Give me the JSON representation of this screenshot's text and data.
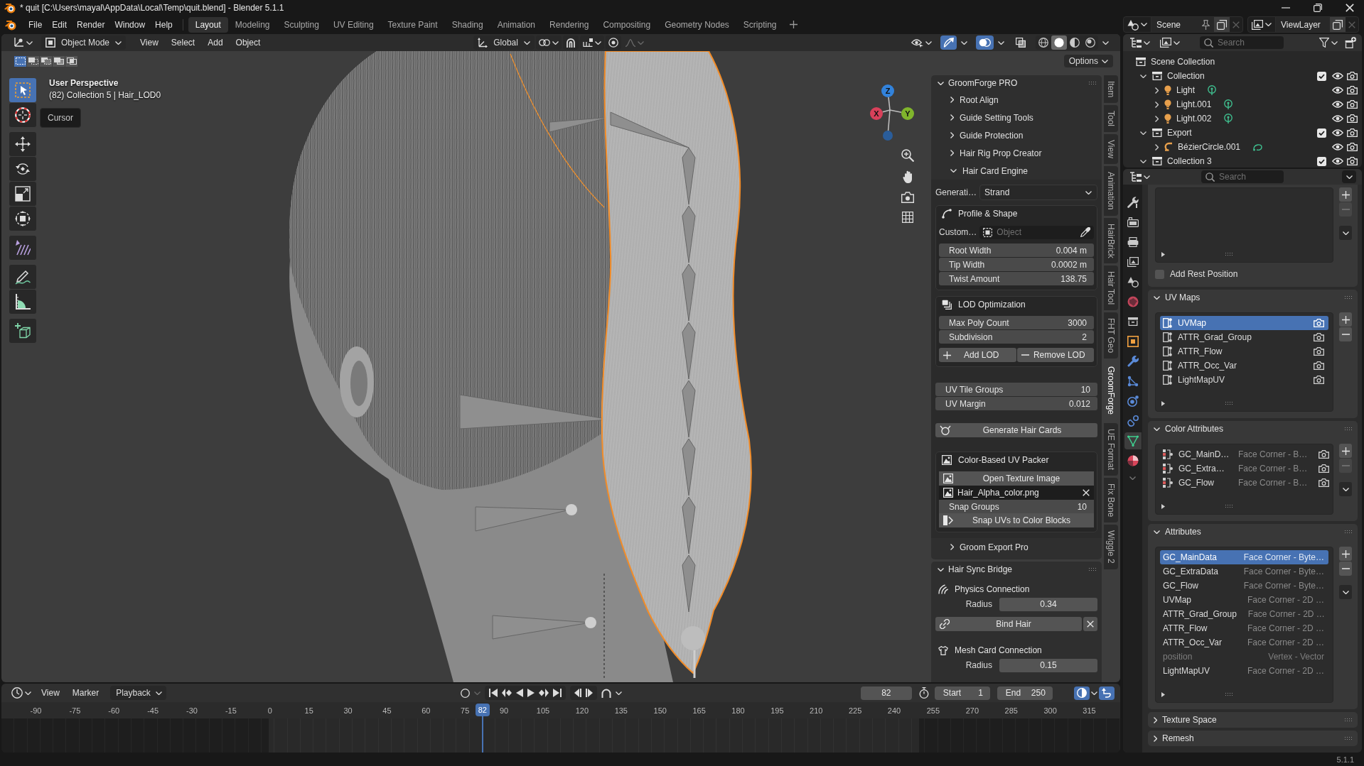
{
  "title_bar": {
    "title": "* quit [C:\\Users\\mayal\\AppData\\Local\\Temp\\quit.blend] - Blender 5.1.1"
  },
  "menu_bar": {
    "menus": [
      "File",
      "Edit",
      "Render",
      "Window",
      "Help"
    ],
    "workspaces": [
      {
        "label": "Layout",
        "selected": true
      },
      {
        "label": "Modeling",
        "selected": false
      },
      {
        "label": "Sculpting",
        "selected": false
      },
      {
        "label": "UV Editing",
        "selected": false
      },
      {
        "label": "Texture Paint",
        "selected": false
      },
      {
        "label": "Shading",
        "selected": false
      },
      {
        "label": "Animation",
        "selected": false
      },
      {
        "label": "Rendering",
        "selected": false
      },
      {
        "label": "Compositing",
        "selected": false
      },
      {
        "label": "Geometry Nodes",
        "selected": false
      },
      {
        "label": "Scripting",
        "selected": false
      }
    ],
    "scene": "Scene",
    "view_layer": "ViewLayer"
  },
  "viewport": {
    "header": {
      "mode": "Object Mode",
      "menus": [
        "View",
        "Select",
        "Add",
        "Object"
      ],
      "orientation": "Global",
      "toggles": [
        {
          "kind": "gizmo",
          "on": true
        },
        {
          "kind": "overlays",
          "on": true
        },
        {
          "kind": "xray",
          "on": false
        }
      ],
      "shading": [
        {
          "kind": "wireframe",
          "selected": false
        },
        {
          "kind": "solid",
          "selected": true
        },
        {
          "kind": "material",
          "selected": false
        },
        {
          "kind": "rendered",
          "selected": false
        }
      ]
    },
    "select_modes": [
      {
        "kind": "set",
        "selected": true
      },
      {
        "kind": "extend",
        "selected": false
      },
      {
        "kind": "subtract",
        "selected": false
      },
      {
        "kind": "difference",
        "selected": false
      },
      {
        "kind": "intersect",
        "selected": false
      }
    ],
    "options": "Options",
    "tools": [
      {
        "kind": "select_box",
        "selected": true
      },
      {
        "kind": "cursor",
        "selected": false
      },
      {
        "kind": "move",
        "selected": false
      },
      {
        "kind": "rotate",
        "selected": false
      },
      {
        "kind": "scale",
        "selected": false
      },
      {
        "kind": "transform",
        "selected": false
      },
      {
        "kind": "strokes",
        "selected": false
      },
      {
        "kind": "annotate",
        "selected": false
      },
      {
        "kind": "measure",
        "selected": false
      },
      {
        "kind": "add_cube",
        "selected": false
      }
    ],
    "view_name": "User Perspective",
    "object_info": "(82) Collection 5 | Hair_LOD0",
    "tooltip": "Cursor",
    "gizmo_axes": [
      {
        "label": "X",
        "color": "#d8405a"
      },
      {
        "label": "Y",
        "color": "#80b52c"
      },
      {
        "label": "Z",
        "color": "#3283dc"
      }
    ]
  },
  "sidebar": {
    "groomforge": {
      "title": "GroomForge PRO",
      "expanded": true,
      "subpanels": [
        {
          "label": "Root Align",
          "expanded": false
        },
        {
          "label": "Guide Setting Tools",
          "expanded": false
        },
        {
          "label": "Guide Protection",
          "expanded": false
        },
        {
          "label": "Hair Rig Prop Creator",
          "expanded": false
        },
        {
          "label": "Hair Card Engine",
          "expanded": true,
          "content": {
            "generation": {
              "label": "Generati…",
              "value": "Strand"
            },
            "profile": {
              "title": "Profile & Shape",
              "custom_label": "Custom…",
              "placeholder": "Object",
              "fields": [
                {
                  "label": "Root Width",
                  "value": "0.004 m"
                },
                {
                  "label": "Tip Width",
                  "value": "0.0002 m"
                },
                {
                  "label": "Twist Amount",
                  "value": "138.75"
                }
              ]
            },
            "lod": {
              "title": "LOD Optimization",
              "fields": [
                {
                  "label": "Max Poly Count",
                  "value": "3000"
                },
                {
                  "label": "Subdivision",
                  "value": "2"
                }
              ],
              "add_button": "Add LOD",
              "remove_button": "Remove LOD"
            },
            "uv_fields": [
              {
                "label": "UV Tile Groups",
                "value": "10"
              },
              {
                "label": "UV Margin",
                "value": "0.012"
              }
            ],
            "generate_button": "Generate Hair Cards",
            "packer": {
              "title": "Color-Based UV Packer",
              "open_button": "Open Texture Image",
              "image_file": "Hair_Alpha_color.png",
              "snap_groups": {
                "label": "Snap Groups",
                "value": "10"
              },
              "snap_button": "Snap UVs to Color Blocks"
            }
          }
        },
        {
          "label": "Groom Export Pro",
          "expanded": false
        }
      ]
    },
    "hair_sync": {
      "title": "Hair Sync Bridge",
      "expanded": true,
      "physics": {
        "title": "Physics Connection",
        "radius_label": "Radius",
        "radius": "0.34",
        "bind_button": "Bind Hair"
      },
      "mesh_card": {
        "title": "Mesh Card Connection",
        "radius_label": "Radius",
        "radius": "0.15"
      }
    },
    "tabs": [
      {
        "label": "Item",
        "selected": false
      },
      {
        "label": "Tool",
        "selected": false
      },
      {
        "label": "View",
        "selected": false
      },
      {
        "label": "Animation",
        "selected": false
      },
      {
        "label": "HairBrick",
        "selected": false
      },
      {
        "label": "Hair Tool",
        "selected": false
      },
      {
        "label": "FHT Geo",
        "selected": false
      },
      {
        "label": "GroomForge",
        "selected": true
      },
      {
        "label": "UE Format",
        "selected": false
      },
      {
        "label": "Fix Bone",
        "selected": false
      },
      {
        "label": "Wiggle 2",
        "selected": false
      }
    ]
  },
  "outliner": {
    "placeholder": "Search",
    "tree": [
      {
        "name": "Scene Collection",
        "kind": "scene_collection",
        "children": [
          {
            "name": "Collection",
            "kind": "collection",
            "expanded": true,
            "checked": true,
            "children": [
              {
                "name": "Light",
                "kind": "light",
                "expanded": false
              },
              {
                "name": "Light.001",
                "kind": "light",
                "expanded": false
              },
              {
                "name": "Light.002",
                "kind": "light",
                "expanded": false
              }
            ]
          },
          {
            "name": "Export",
            "kind": "collection",
            "expanded": true,
            "checked": true,
            "children": [
              {
                "name": "BézierCircle.001",
                "kind": "curve",
                "expanded": false
              }
            ]
          },
          {
            "name": "Collection 3",
            "kind": "collection",
            "expanded": true,
            "checked": true
          }
        ]
      }
    ]
  },
  "properties": {
    "placeholder": "Search",
    "tabs": [
      {
        "kind": "tool",
        "selected": false
      },
      {
        "kind": "render",
        "selected": false
      },
      {
        "kind": "output",
        "selected": false
      },
      {
        "kind": "view_layer",
        "selected": false
      },
      {
        "kind": "scene",
        "selected": false
      },
      {
        "kind": "world",
        "selected": false
      },
      {
        "kind": "collection",
        "selected": false
      },
      {
        "kind": "object",
        "selected": false
      },
      {
        "kind": "modifiers",
        "selected": false
      },
      {
        "kind": "particles",
        "selected": false
      },
      {
        "kind": "physics",
        "selected": false
      },
      {
        "kind": "constraints",
        "selected": false
      },
      {
        "kind": "data",
        "selected": true
      },
      {
        "kind": "material",
        "selected": false
      }
    ],
    "rest_position": {
      "label": "Add Rest Position",
      "checked": false
    },
    "uv_maps": {
      "title": "UV Maps",
      "expanded": true,
      "items": [
        {
          "name": "UVMap",
          "selected": true
        },
        {
          "name": "ATTR_Grad_Group",
          "selected": false
        },
        {
          "name": "ATTR_Flow",
          "selected": false
        },
        {
          "name": "ATTR_Occ_Var",
          "selected": false
        },
        {
          "name": "LightMapUV",
          "selected": false
        }
      ]
    },
    "color_attributes": {
      "title": "Color Attributes",
      "expanded": true,
      "items": [
        {
          "name": "GC_MainD…",
          "domain": "Face Corner - B…",
          "selected": false
        },
        {
          "name": "GC_Extra…",
          "domain": "Face Corner - B…",
          "selected": false
        },
        {
          "name": "GC_Flow",
          "domain": "Face Corner - B…",
          "selected": false
        }
      ]
    },
    "attributes": {
      "title": "Attributes",
      "expanded": true,
      "items": [
        {
          "name": "GC_MainData",
          "domain": "Face Corner - Byte…",
          "selected": true,
          "internal": false
        },
        {
          "name": "GC_ExtraData",
          "domain": "Face Corner - Byte…",
          "selected": false,
          "internal": false
        },
        {
          "name": "GC_Flow",
          "domain": "Face Corner - Byte…",
          "selected": false,
          "internal": false
        },
        {
          "name": "UVMap",
          "domain": "Face Corner - 2D …",
          "selected": false,
          "internal": false
        },
        {
          "name": "ATTR_Grad_Group",
          "domain": "Face Corner - 2D …",
          "selected": false,
          "internal": false
        },
        {
          "name": "ATTR_Flow",
          "domain": "Face Corner - 2D …",
          "selected": false,
          "internal": false
        },
        {
          "name": "ATTR_Occ_Var",
          "domain": "Face Corner - 2D …",
          "selected": false,
          "internal": false
        },
        {
          "name": "position",
          "domain": "Vertex - Vector",
          "selected": false,
          "internal": true
        },
        {
          "name": "LightMapUV",
          "domain": "Face Corner - 2D …",
          "selected": false,
          "internal": false
        }
      ]
    },
    "collapsed_panels": [
      {
        "title": "Texture Space",
        "expanded": false
      },
      {
        "title": "Remesh",
        "expanded": false
      }
    ]
  },
  "timeline": {
    "menus": [
      "View",
      "Marker"
    ],
    "playback": "Playback",
    "current_frame": "82",
    "start_label": "Start",
    "start": "1",
    "end_label": "End",
    "end": "250",
    "ruler": [
      "-90",
      "-75",
      "-60",
      "-45",
      "-30",
      "-15",
      "0",
      "15",
      "30",
      "45",
      "60",
      "75",
      "90",
      "105",
      "120",
      "135",
      "150",
      "165",
      "180",
      "195",
      "210",
      "225",
      "240",
      "255",
      "270",
      "285",
      "300",
      "315"
    ],
    "playhead": {
      "label": "82",
      "level": 0.43
    }
  },
  "status_bar": {
    "version": "5.1.1"
  }
}
